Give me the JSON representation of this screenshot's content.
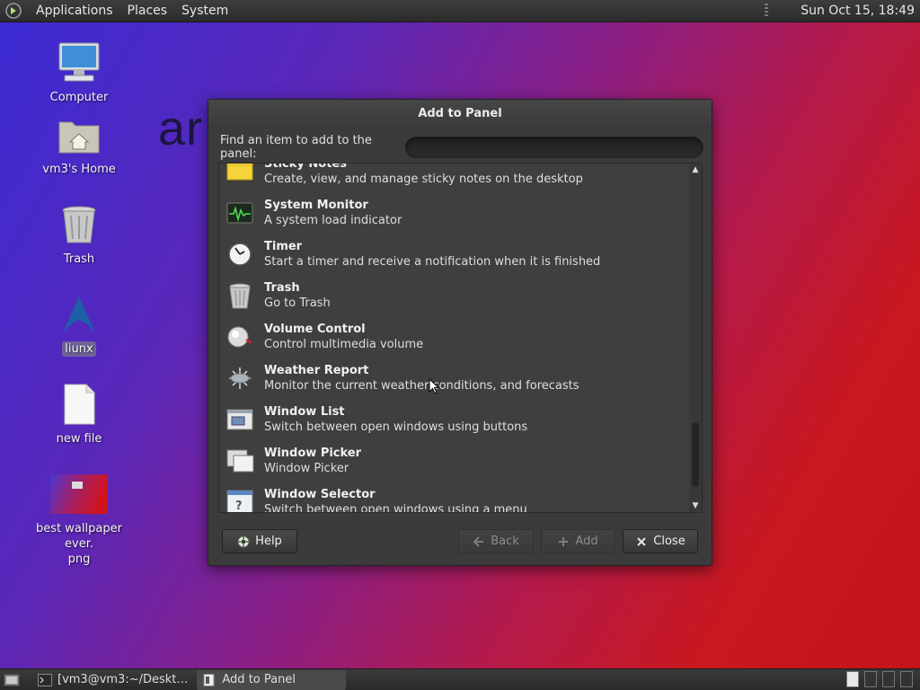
{
  "top_panel": {
    "menus": [
      "Applications",
      "Places",
      "System"
    ],
    "clock": "Sun Oct 15, 18:49"
  },
  "desktop": {
    "background_text": "ar",
    "icons": [
      {
        "label": "Computer",
        "icon": "computer-icon"
      },
      {
        "label": "vm3's Home",
        "icon": "home-folder-icon"
      },
      {
        "label": "Trash",
        "icon": "trash-icon"
      },
      {
        "label": "liunx",
        "icon": "arch-logo-icon"
      },
      {
        "label": "new file",
        "icon": "file-icon"
      },
      {
        "label": "best wallpaper ever.\npng",
        "label_line1": "best wallpaper ever.",
        "label_line2": "png",
        "icon": "image-thumbnail-icon"
      }
    ]
  },
  "dialog": {
    "title": "Add to Panel",
    "find_label": "Find an item to add to the panel:",
    "search_value": "",
    "items": [
      {
        "name": "Sticky Notes",
        "desc": "Create, view, and manage sticky notes on the desktop",
        "icon": "sticky-notes-icon"
      },
      {
        "name": "System Monitor",
        "desc": "A system load indicator",
        "icon": "system-monitor-icon"
      },
      {
        "name": "Timer",
        "desc": "Start a timer and receive a notification when it is finished",
        "icon": "timer-icon"
      },
      {
        "name": "Trash",
        "desc": "Go to Trash",
        "icon": "trash-icon"
      },
      {
        "name": "Volume Control",
        "desc": "Control multimedia volume",
        "icon": "volume-icon"
      },
      {
        "name": "Weather Report",
        "desc": "Monitor the current weather conditions, and forecasts",
        "icon": "weather-icon"
      },
      {
        "name": "Window List",
        "desc": "Switch between open windows using buttons",
        "icon": "window-list-icon"
      },
      {
        "name": "Window Picker",
        "desc": "Window Picker",
        "icon": "window-picker-icon"
      },
      {
        "name": "Window Selector",
        "desc": "Switch between open windows using a menu",
        "icon": "window-selector-icon"
      }
    ],
    "buttons": {
      "help": "Help",
      "back": "Back",
      "add": "Add",
      "close": "Close"
    }
  },
  "bottom_panel": {
    "tasks": [
      {
        "label": "[vm3@vm3:~/Deskt…",
        "icon": "terminal-icon",
        "active": false
      },
      {
        "label": "Add to Panel",
        "icon": "window-icon",
        "active": true
      }
    ]
  }
}
